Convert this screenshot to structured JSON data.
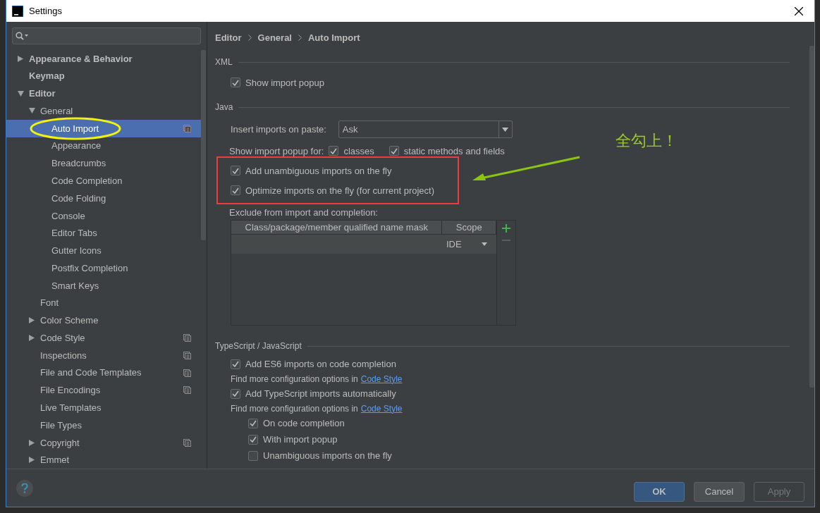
{
  "window": {
    "title": "Settings"
  },
  "tree": [
    {
      "label": "Appearance & Behavior",
      "expanded": false,
      "selected": false
    },
    {
      "label": "Keymap",
      "selected": false
    },
    {
      "label": "Editor",
      "expanded": true,
      "selected": false,
      "children": [
        {
          "label": "General",
          "expanded": true,
          "selected": false,
          "children": [
            {
              "label": "Auto Import",
              "selected": true,
              "project": true,
              "circled": true
            },
            {
              "label": "Appearance",
              "selected": false
            },
            {
              "label": "Breadcrumbs",
              "selected": false
            },
            {
              "label": "Code Completion",
              "selected": false
            },
            {
              "label": "Code Folding",
              "selected": false
            },
            {
              "label": "Console",
              "selected": false
            },
            {
              "label": "Editor Tabs",
              "selected": false
            },
            {
              "label": "Gutter Icons",
              "selected": false
            },
            {
              "label": "Postfix Completion",
              "selected": false
            },
            {
              "label": "Smart Keys",
              "selected": false
            }
          ]
        },
        {
          "label": "Font",
          "selected": false
        },
        {
          "label": "Color Scheme",
          "expanded": false,
          "selected": false
        },
        {
          "label": "Code Style",
          "expanded": false,
          "selected": false,
          "project": true
        },
        {
          "label": "Inspections",
          "selected": false,
          "project": true
        },
        {
          "label": "File and Code Templates",
          "selected": false,
          "project": true
        },
        {
          "label": "File Encodings",
          "selected": false,
          "project": true
        },
        {
          "label": "Live Templates",
          "selected": false
        },
        {
          "label": "File Types",
          "selected": false
        },
        {
          "label": "Copyright",
          "expanded": false,
          "selected": false,
          "project": true
        },
        {
          "label": "Emmet",
          "expanded": false,
          "selected": false
        }
      ]
    }
  ],
  "breadcrumb": [
    "Editor",
    "General",
    "Auto Import"
  ],
  "sections": [
    {
      "title": "XML",
      "options": [
        {
          "kind": "checkbox",
          "label": "Show import popup",
          "checked": true
        }
      ]
    },
    {
      "title": "Java",
      "options": [
        {
          "kind": "dropdown",
          "label": "Insert imports on paste:",
          "value": "Ask"
        },
        {
          "kind": "checkgroup",
          "label": "Show import popup for:",
          "items": [
            {
              "label": "classes",
              "checked": true
            },
            {
              "label": "static methods and fields",
              "checked": true
            }
          ]
        },
        {
          "kind": "checkbox",
          "label": "Add unambiguous imports on the fly",
          "checked": true,
          "highlighted": true
        },
        {
          "kind": "checkbox",
          "label": "Optimize imports on the fly (for current project)",
          "checked": true,
          "highlighted": true
        },
        {
          "kind": "table",
          "label": "Exclude from import and completion:",
          "columns": [
            "Class/package/member qualified name mask",
            "Scope"
          ],
          "rows": [
            {
              "scope": "IDE"
            }
          ]
        }
      ]
    },
    {
      "title": "TypeScript / JavaScript",
      "options": [
        {
          "kind": "checkbox",
          "label": "Add ES6 imports on code completion",
          "checked": true
        },
        {
          "kind": "hint",
          "text": "Find more configuration options in",
          "link": "Code Style"
        },
        {
          "kind": "checkbox",
          "label": "Add TypeScript imports automatically",
          "checked": true
        },
        {
          "kind": "hint",
          "text": "Find more configuration options in",
          "link": "Code Style"
        },
        {
          "kind": "subgroup",
          "children": [
            {
              "kind": "checkbox",
              "label": "On code completion",
              "checked": true
            },
            {
              "kind": "checkbox",
              "label": "With import popup",
              "checked": true
            },
            {
              "kind": "checkbox",
              "label": "Unambiguous imports on the fly",
              "checked": false
            }
          ]
        }
      ]
    }
  ],
  "annotation": {
    "note": "全勾上！"
  },
  "buttons": [
    {
      "label": "OK",
      "default": true,
      "disabled": false
    },
    {
      "label": "Cancel",
      "default": false,
      "disabled": false
    },
    {
      "label": "Apply",
      "default": false,
      "disabled": true
    }
  ]
}
